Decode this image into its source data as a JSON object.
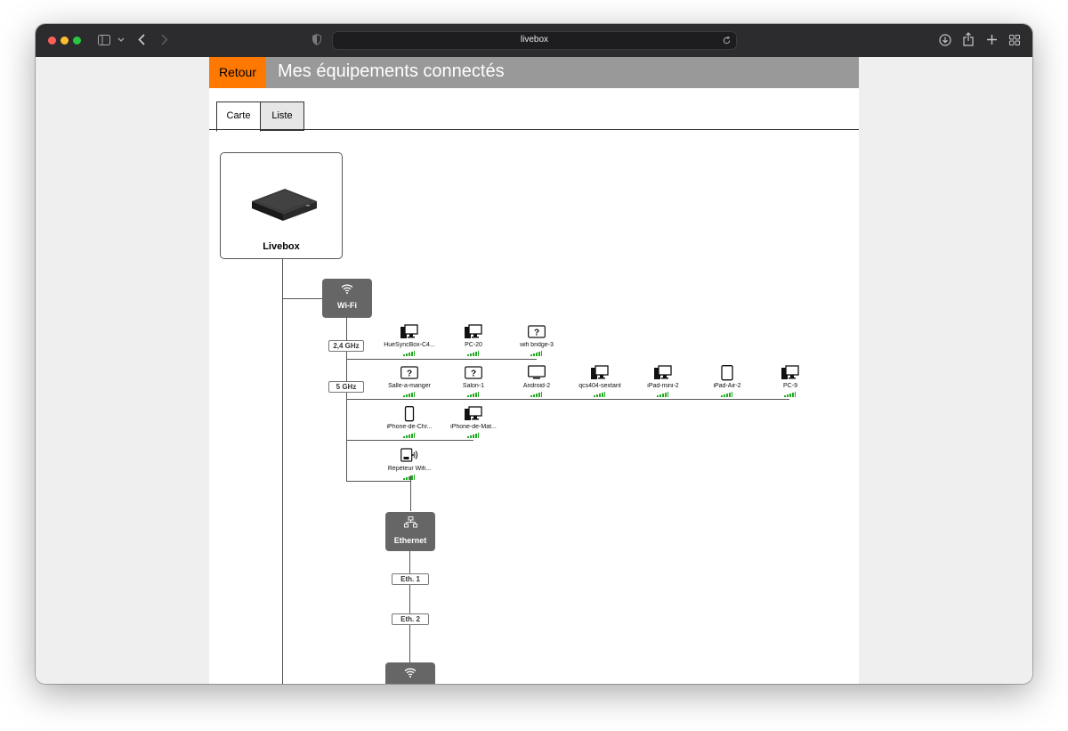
{
  "browser": {
    "url": "livebox"
  },
  "header": {
    "back_label": "Retour",
    "title": "Mes équipements connectés"
  },
  "tabs": [
    {
      "label": "Carte",
      "active": true
    },
    {
      "label": "Liste",
      "active": false
    }
  ],
  "livebox": {
    "label": "Livebox"
  },
  "wifi_hub": {
    "label": "Wi-Fi",
    "icon": "wifi-icon"
  },
  "bands": {
    "ghz24": "2,4 GHz",
    "ghz5": "5 GHz"
  },
  "devices_24ghz": [
    {
      "label": "HueSyncBox-C4...",
      "icon": "desktop-icon"
    },
    {
      "label": "PC-20",
      "icon": "desktop-icon"
    },
    {
      "label": "wifi bridge-3",
      "icon": "unknown-device-icon"
    }
  ],
  "devices_5ghz": [
    {
      "label": "Salle-a-manger",
      "icon": "unknown-device-icon"
    },
    {
      "label": "Salon-1",
      "icon": "unknown-device-icon"
    },
    {
      "label": "Android-2",
      "icon": "tv-icon"
    },
    {
      "label": "qcs404-sextant",
      "icon": "desktop-icon"
    },
    {
      "label": "iPad-mini-2",
      "icon": "desktop-icon"
    },
    {
      "label": "iPad-Air-2",
      "icon": "tablet-icon"
    },
    {
      "label": "PC-9",
      "icon": "desktop-icon"
    }
  ],
  "devices_5ghz_row2": [
    {
      "label": "iPhone-de-Chr...",
      "icon": "phone-icon"
    },
    {
      "label": "iPhone-de-Mat...",
      "icon": "desktop-icon"
    }
  ],
  "devices_row3": [
    {
      "label": "Répéteur Wifi...",
      "icon": "repeater-icon"
    }
  ],
  "ethernet_hub": {
    "label": "Ethernet",
    "icon": "ethernet-icon"
  },
  "eth_ports": {
    "eth1": "Eth. 1",
    "eth2": "Eth. 2"
  },
  "colors": {
    "accent": "#ff7900",
    "header_bg": "#999999",
    "hub_bg": "#666666",
    "signal": "#22aa22"
  }
}
